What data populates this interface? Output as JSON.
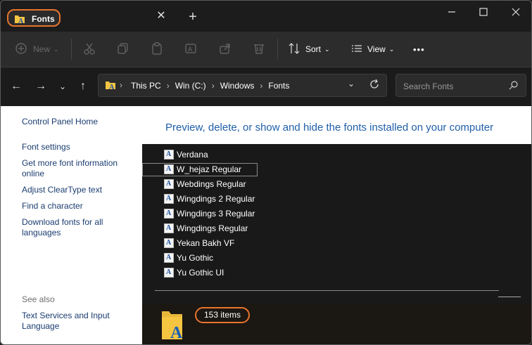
{
  "window": {
    "tab_title": "Fonts",
    "tab_close": "✕",
    "new_tab": "+",
    "minimize": "—",
    "maximize": "☐",
    "close": "✕"
  },
  "toolbar": {
    "new_label": "New",
    "sort_label": "Sort",
    "view_label": "View",
    "more": "•••"
  },
  "address": {
    "crumbs": [
      "This PC",
      "Win (C:)",
      "Windows",
      "Fonts"
    ]
  },
  "search": {
    "placeholder": "Search Fonts"
  },
  "left_pane": {
    "home": "Control Panel Home",
    "links": [
      "Font settings",
      "Get more font information online",
      "Adjust ClearType text",
      "Find a character",
      "Download fonts for all languages"
    ],
    "see_also_heading": "See also",
    "see_also_links": [
      "Text Services and Input Language"
    ]
  },
  "content": {
    "heading": "Preview, delete, or show and hide the fonts installed on your computer",
    "fonts": [
      "Verdana",
      "W_hejaz Regular",
      "Webdings Regular",
      "Wingdings 2 Regular",
      "Wingdings 3 Regular",
      "Wingdings Regular",
      "Yekan Bakh VF",
      "Yu Gothic",
      "Yu Gothic UI"
    ],
    "selected_index": 1
  },
  "details": {
    "item_count": "153 items"
  },
  "colors": {
    "highlight": "#e8742c",
    "link": "#1a3c70",
    "heading": "#1f5fa8"
  }
}
